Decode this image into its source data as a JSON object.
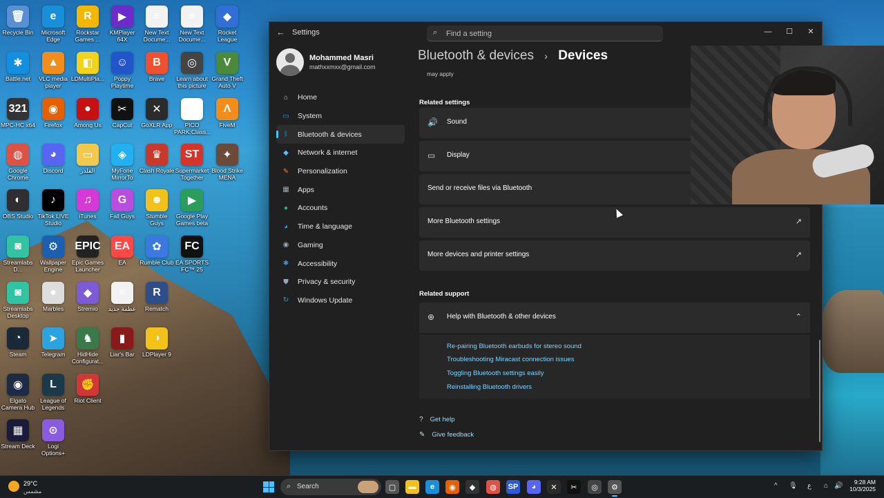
{
  "desktop": {
    "icons": [
      {
        "label": "Recycle Bin",
        "glyph": "🗑",
        "color": "#5a8fd6"
      },
      {
        "label": "Microsoft Edge",
        "glyph": "e",
        "color": "#1a8fd9"
      },
      {
        "label": "Rockstar Games ...",
        "glyph": "R",
        "color": "#f2b705"
      },
      {
        "label": "KMPlayer 64X",
        "glyph": "▶",
        "color": "#6b2cc9"
      },
      {
        "label": "New Text Docume...",
        "glyph": "≡",
        "color": "#f2f2f2"
      },
      {
        "label": "New Text Docume...",
        "glyph": "≡",
        "color": "#f2f2f2"
      },
      {
        "label": "Rocket League",
        "glyph": "◆",
        "color": "#2f6fd6"
      },
      {
        "label": "Battle.net",
        "glyph": "✱",
        "color": "#148ee0"
      },
      {
        "label": "VLC media player",
        "glyph": "▲",
        "color": "#f28c1b"
      },
      {
        "label": "LDMultiPla...",
        "glyph": "◧",
        "color": "#f2d21b"
      },
      {
        "label": "Poppy Playtime",
        "glyph": "☺",
        "color": "#2255c9"
      },
      {
        "label": "Brave",
        "glyph": "B",
        "color": "#f1502f"
      },
      {
        "label": "Learn about this picture",
        "glyph": "◎",
        "color": "#444444"
      },
      {
        "label": "Grand Theft Auto V",
        "glyph": "V",
        "color": "#4a8a3a"
      },
      {
        "label": "MPC-HC x64",
        "glyph": "321",
        "color": "#333333"
      },
      {
        "label": "Firefox",
        "glyph": "◉",
        "color": "#e66000"
      },
      {
        "label": "Among Us",
        "glyph": "●",
        "color": "#c51111"
      },
      {
        "label": "CapCut",
        "glyph": "✂",
        "color": "#111111"
      },
      {
        "label": "GoXLR App",
        "glyph": "✕",
        "color": "#2b2b2b"
      },
      {
        "label": "PICO PARK:Class...",
        "glyph": "▦",
        "color": "#ffffff"
      },
      {
        "label": "FiveM",
        "glyph": "Λ",
        "color": "#f28c1b"
      },
      {
        "label": "Google Chrome",
        "glyph": "◍",
        "color": "#de5246"
      },
      {
        "label": "Discord",
        "glyph": "◕",
        "color": "#5865f2"
      },
      {
        "label": "الفلدر",
        "glyph": "▭",
        "color": "#f2c94c"
      },
      {
        "label": "MyFone MirrorTo",
        "glyph": "◈",
        "color": "#23b0f0"
      },
      {
        "label": "Clash Royale",
        "glyph": "♛",
        "color": "#c9392b"
      },
      {
        "label": "Supermarket Together",
        "glyph": "ST",
        "color": "#d6342a"
      },
      {
        "label": "Blood Strike MENA",
        "glyph": "✦",
        "color": "#6b4a3a"
      },
      {
        "label": "OBS Studio",
        "glyph": "◐",
        "color": "#302e31"
      },
      {
        "label": "TikTok LIVE Studio",
        "glyph": "♪",
        "color": "#000000"
      },
      {
        "label": "iTunes",
        "glyph": "♫",
        "color": "#d63ad6"
      },
      {
        "label": "Fall Guys",
        "glyph": "G",
        "color": "#b84de0"
      },
      {
        "label": "Stumble Guys",
        "glyph": "☻",
        "color": "#f2c21b"
      },
      {
        "label": "Google Play Games beta",
        "glyph": "▶",
        "color": "#2a9d5a"
      },
      {
        "label": "Streamlabs D...",
        "glyph": "◙",
        "color": "#31c3a2"
      },
      {
        "label": "Wallpaper Engine",
        "glyph": "⚙",
        "color": "#1c5fb0"
      },
      {
        "label": "Epic Games Launcher",
        "glyph": "EPIC",
        "color": "#222222"
      },
      {
        "label": "EA",
        "glyph": "EA",
        "color": "#ff4747"
      },
      {
        "label": "Rumble Club",
        "glyph": "✿",
        "color": "#3a7ae0"
      },
      {
        "label": "EA SPORTS FC™ 25",
        "glyph": "FC",
        "color": "#111111"
      },
      {
        "label": "Streamlabs Desktop",
        "glyph": "◙",
        "color": "#31c3a2"
      },
      {
        "label": "Marbles",
        "glyph": "●",
        "color": "#dddddd"
      },
      {
        "label": "Stremio",
        "glyph": "◆",
        "color": "#7b5bd6"
      },
      {
        "label": "عظمة جديد",
        "glyph": "≡",
        "color": "#f2f2f2"
      },
      {
        "label": "Rematch",
        "glyph": "R",
        "color": "#2e4e8a"
      },
      {
        "label": "Steam",
        "glyph": "◔",
        "color": "#1b2838"
      },
      {
        "label": "Telegram",
        "glyph": "➤",
        "color": "#2aa3de"
      },
      {
        "label": "HidHide Configurat...",
        "glyph": "♞",
        "color": "#3a7a4a"
      },
      {
        "label": "Liar's Bar",
        "glyph": "▮",
        "color": "#8a1a1a"
      },
      {
        "label": "LDPlayer 9",
        "glyph": "◑",
        "color": "#f2c21b"
      },
      {
        "label": "Elgato Camera Hub",
        "glyph": "◉",
        "color": "#1f2a44"
      },
      {
        "label": "League of Legends",
        "glyph": "L",
        "color": "#1a3a4a"
      },
      {
        "label": "Riot Client",
        "glyph": "✊",
        "color": "#d13639"
      },
      {
        "label": "Stream Deck",
        "glyph": "▦",
        "color": "#1a1a3a"
      },
      {
        "label": "Logi Options+",
        "glyph": "⊙",
        "color": "#8a5be0"
      }
    ]
  },
  "window": {
    "app_title": "Settings",
    "back_glyph": "←",
    "search": {
      "placeholder": "Find a setting",
      "value": ""
    },
    "controls": {
      "minimize": "—",
      "maximize": "☐",
      "close": "✕"
    },
    "profile": {
      "name": "Mohammed Masri",
      "email": "mathxxmxx@gmail.com"
    },
    "nav": [
      {
        "label": "Home",
        "glyph": "⌂",
        "color": "#cccccc",
        "active": false
      },
      {
        "label": "System",
        "glyph": "▭",
        "color": "#2b9be0",
        "active": false
      },
      {
        "label": "Bluetooth & devices",
        "glyph": "ᛒ",
        "color": "#2b9be0",
        "active": true
      },
      {
        "label": "Network & internet",
        "glyph": "◆",
        "color": "#4cc2ff",
        "active": false
      },
      {
        "label": "Personalization",
        "glyph": "✎",
        "color": "#e8833a",
        "active": false
      },
      {
        "label": "Apps",
        "glyph": "▦",
        "color": "#9aa7b8",
        "active": false
      },
      {
        "label": "Accounts",
        "glyph": "●",
        "color": "#2fb67c",
        "active": false
      },
      {
        "label": "Time & language",
        "glyph": "◕",
        "color": "#2b9be0",
        "active": false
      },
      {
        "label": "Gaming",
        "glyph": "◉",
        "color": "#9aa7b8",
        "active": false
      },
      {
        "label": "Accessibility",
        "glyph": "✱",
        "color": "#2b9be0",
        "active": false
      },
      {
        "label": "Privacy & security",
        "glyph": "⛊",
        "color": "#9aa7b8",
        "active": false
      },
      {
        "label": "Windows Update",
        "glyph": "↻",
        "color": "#2b9be0",
        "active": false
      }
    ],
    "breadcrumb": {
      "parent": "Bluetooth & devices",
      "separator": "›",
      "current": "Devices"
    },
    "truncated_text": "may apply",
    "related_settings": {
      "title": "Related settings",
      "items": [
        {
          "label": "Sound",
          "glyph": "🔊",
          "external": false
        },
        {
          "label": "Display",
          "glyph": "▭",
          "external": false
        },
        {
          "label": "Send or receive files via Bluetooth",
          "glyph": "",
          "external": false
        },
        {
          "label": "More Bluetooth settings",
          "glyph": "",
          "external": true
        },
        {
          "label": "More devices and printer settings",
          "glyph": "",
          "external": true
        }
      ],
      "external_glyph": "↗"
    },
    "related_support": {
      "title": "Related support",
      "help": {
        "label": "Help with Bluetooth & other devices",
        "glyph": "⊕",
        "chevron": "⌃"
      },
      "links": [
        "Re-pairing Bluetooth earbuds for stereo sound",
        "Troubleshooting Miracast connection issues",
        "Toggling Bluetooth settings easily",
        "Reinstalling Bluetooth drivers"
      ]
    },
    "footer": [
      {
        "label": "Get help",
        "glyph": "?"
      },
      {
        "label": "Give feedback",
        "glyph": "✎"
      }
    ]
  },
  "taskbar": {
    "weather": {
      "temp": "29°C",
      "subtitle": "مشمس"
    },
    "search_label": "Search",
    "apps": [
      {
        "name": "file-explorer",
        "glyph": "▬",
        "color": "#f2c21b",
        "active": false
      },
      {
        "name": "task-view",
        "glyph": "▢",
        "color": "#555555",
        "active": false
      },
      {
        "name": "edge",
        "glyph": "e",
        "color": "#1a8fd9",
        "active": false
      },
      {
        "name": "firefox",
        "glyph": "◉",
        "color": "#e66000",
        "active": false
      },
      {
        "name": "unity",
        "glyph": "◆",
        "color": "#333333",
        "active": false
      },
      {
        "name": "chrome",
        "glyph": "◍",
        "color": "#de5246",
        "active": false
      },
      {
        "name": "app-blue",
        "glyph": "SP",
        "color": "#2a5bd6",
        "active": false
      },
      {
        "name": "discord",
        "glyph": "◕",
        "color": "#5865f2",
        "active": false
      },
      {
        "name": "goxlr",
        "glyph": "✕",
        "color": "#2b2b2b",
        "active": false
      },
      {
        "name": "capcut",
        "glyph": "✂",
        "color": "#111111",
        "active": false
      },
      {
        "name": "browser",
        "glyph": "◎",
        "color": "#444444",
        "active": false
      },
      {
        "name": "settings",
        "glyph": "⚙",
        "color": "#555555",
        "active": true
      }
    ],
    "tray": {
      "chevron": "^",
      "mic": "🎙",
      "lang": "ع",
      "wifi": "⌂",
      "volume": "🔊",
      "battery": "▭"
    },
    "clock": {
      "time": "9:28 AM",
      "date": "10/3/2025"
    }
  }
}
